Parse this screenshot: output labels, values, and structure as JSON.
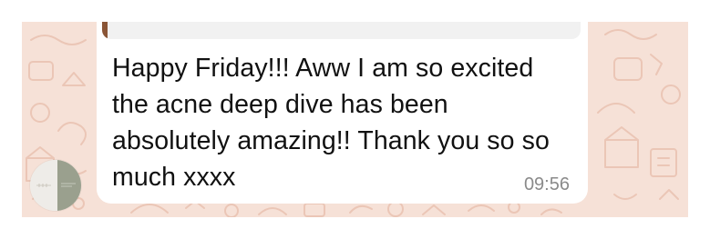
{
  "conversation": {
    "message": {
      "text": "Happy Friday!!! Aww I am so excited the acne deep dive has been absolutely amazing!! Thank you so so much xxxx",
      "time": "09:56"
    },
    "avatar": {
      "icon": "brand-logo-avatar"
    }
  },
  "colors": {
    "wallpaper": "#f6e1d7",
    "bubble": "#ffffff",
    "quote_bar": "#8a5536",
    "timestamp": "#8a8a8a",
    "avatar_accent": "#9aa08e"
  }
}
